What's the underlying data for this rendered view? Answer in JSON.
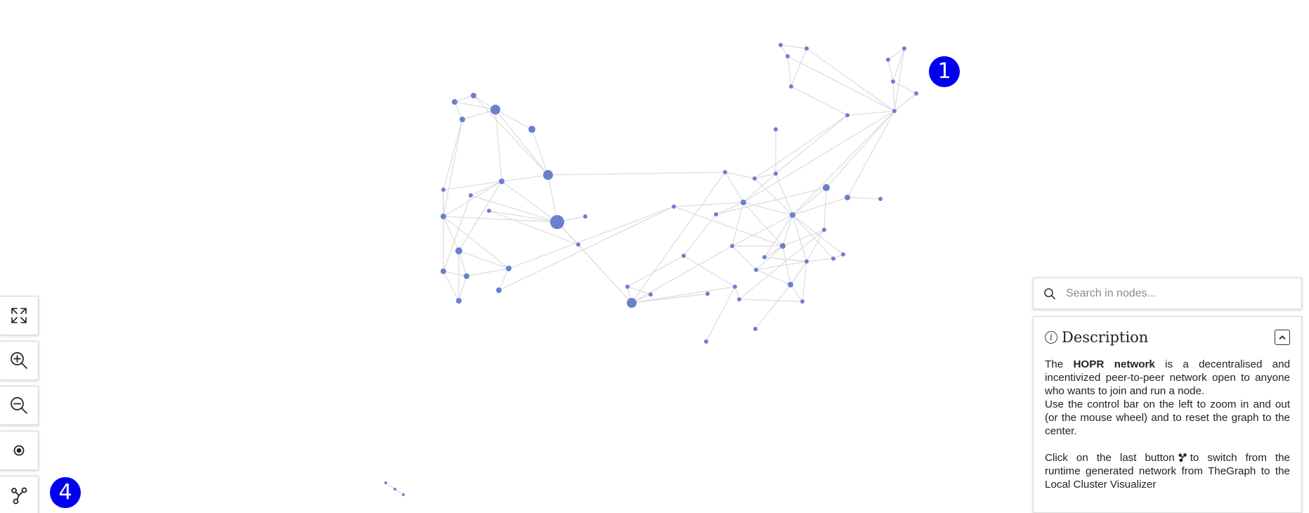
{
  "markers": [
    "1",
    "4"
  ],
  "controls": [
    {
      "name": "fullscreen-button",
      "icon": "expand-arrows-icon"
    },
    {
      "name": "zoom-in-button",
      "icon": "zoom-in-icon"
    },
    {
      "name": "zoom-out-button",
      "icon": "zoom-out-icon"
    },
    {
      "name": "reset-center-button",
      "icon": "target-icon"
    },
    {
      "name": "switch-network-button",
      "icon": "network-graph-icon"
    }
  ],
  "search": {
    "placeholder": "Search in nodes..."
  },
  "description": {
    "title": "Description",
    "info_symbol": "i",
    "p1_pre": "The ",
    "p1_bold": "HOPR network",
    "p1_post": " is a decentralised and incentivized peer-to-peer network open to anyone who wants to join and run a node.",
    "p2": "Use the control bar on the left to zoom in and out (or the mouse wheel) and to reset the graph to the center.",
    "p3_pre": "Click on the last button",
    "p3_post": "to switch from the runtime generated network from TheGraph to the Local Cluster Visualizer"
  },
  "colors": {
    "node": "#6b80cc",
    "edge": "#dcdcdc",
    "marker": "#0000ee"
  }
}
